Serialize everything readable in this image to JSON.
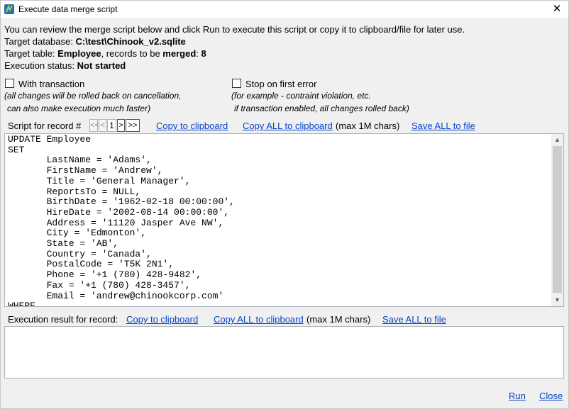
{
  "window": {
    "title": "Execute data merge script",
    "close_symbol": "✕"
  },
  "info": {
    "intro": "You can review the merge script below and click Run to execute this script or copy it to clipboard/file for later use.",
    "db_label": "Target database: ",
    "db_value": "C:\\test\\Chinook_v2.sqlite",
    "table_label": "Target table: ",
    "table_value": "Employee",
    "records_label": ", records to be ",
    "records_bold": "merged",
    "records_colon": ": ",
    "records_count": "8",
    "status_label": "Execution status: ",
    "status_value": "Not started"
  },
  "options": {
    "transaction": {
      "label": "With transaction",
      "checked": false,
      "note_line1": "(all changes will be rolled back on cancellation,",
      "note_line2": "can also make execution much faster)"
    },
    "stop_on_error": {
      "label": "Stop on first error",
      "checked": false,
      "note_line1": "(for example - contraint violation, etc.",
      "note_line2": "if transaction enabled, all changes rolled back)"
    }
  },
  "script_toolbar": {
    "label": "Script for record #",
    "nav_first": "<<",
    "nav_prev": "<",
    "page": "1",
    "nav_next": ">",
    "nav_last": ">>",
    "copy_label": "Copy to clipboard",
    "copy_all_label": "Copy ALL to clipboard",
    "max_note": "(max 1M chars)",
    "save_all_label": "Save ALL to file"
  },
  "script_text": "UPDATE Employee\nSET\n       LastName = 'Adams',\n       FirstName = 'Andrew',\n       Title = 'General Manager',\n       ReportsTo = NULL,\n       BirthDate = '1962-02-18 00:00:00',\n       HireDate = '2002-08-14 00:00:00',\n       Address = '11120 Jasper Ave NW',\n       City = 'Edmonton',\n       State = 'AB',\n       Country = 'Canada',\n       PostalCode = 'T5K 2N1',\n       Phone = '+1 (780) 428-9482',\n       Fax = '+1 (780) 428-3457',\n       Email = 'andrew@chinookcorp.com'\nWHERE",
  "result_toolbar": {
    "label": "Execution result for record:",
    "copy_label": "Copy to clipboard",
    "copy_all_label": "Copy ALL to clipboard",
    "max_note": "(max 1M chars)",
    "save_all_label": "Save ALL to file"
  },
  "result_text": "",
  "footer": {
    "run_label": "Run",
    "close_label": "Close"
  },
  "colors": {
    "link": "#0645c8",
    "background": "#f0f0f0"
  },
  "icons": {
    "app": "app-icon",
    "close": "close-icon",
    "scroll_up": "scroll-up-icon",
    "scroll_down": "scroll-down-icon"
  }
}
